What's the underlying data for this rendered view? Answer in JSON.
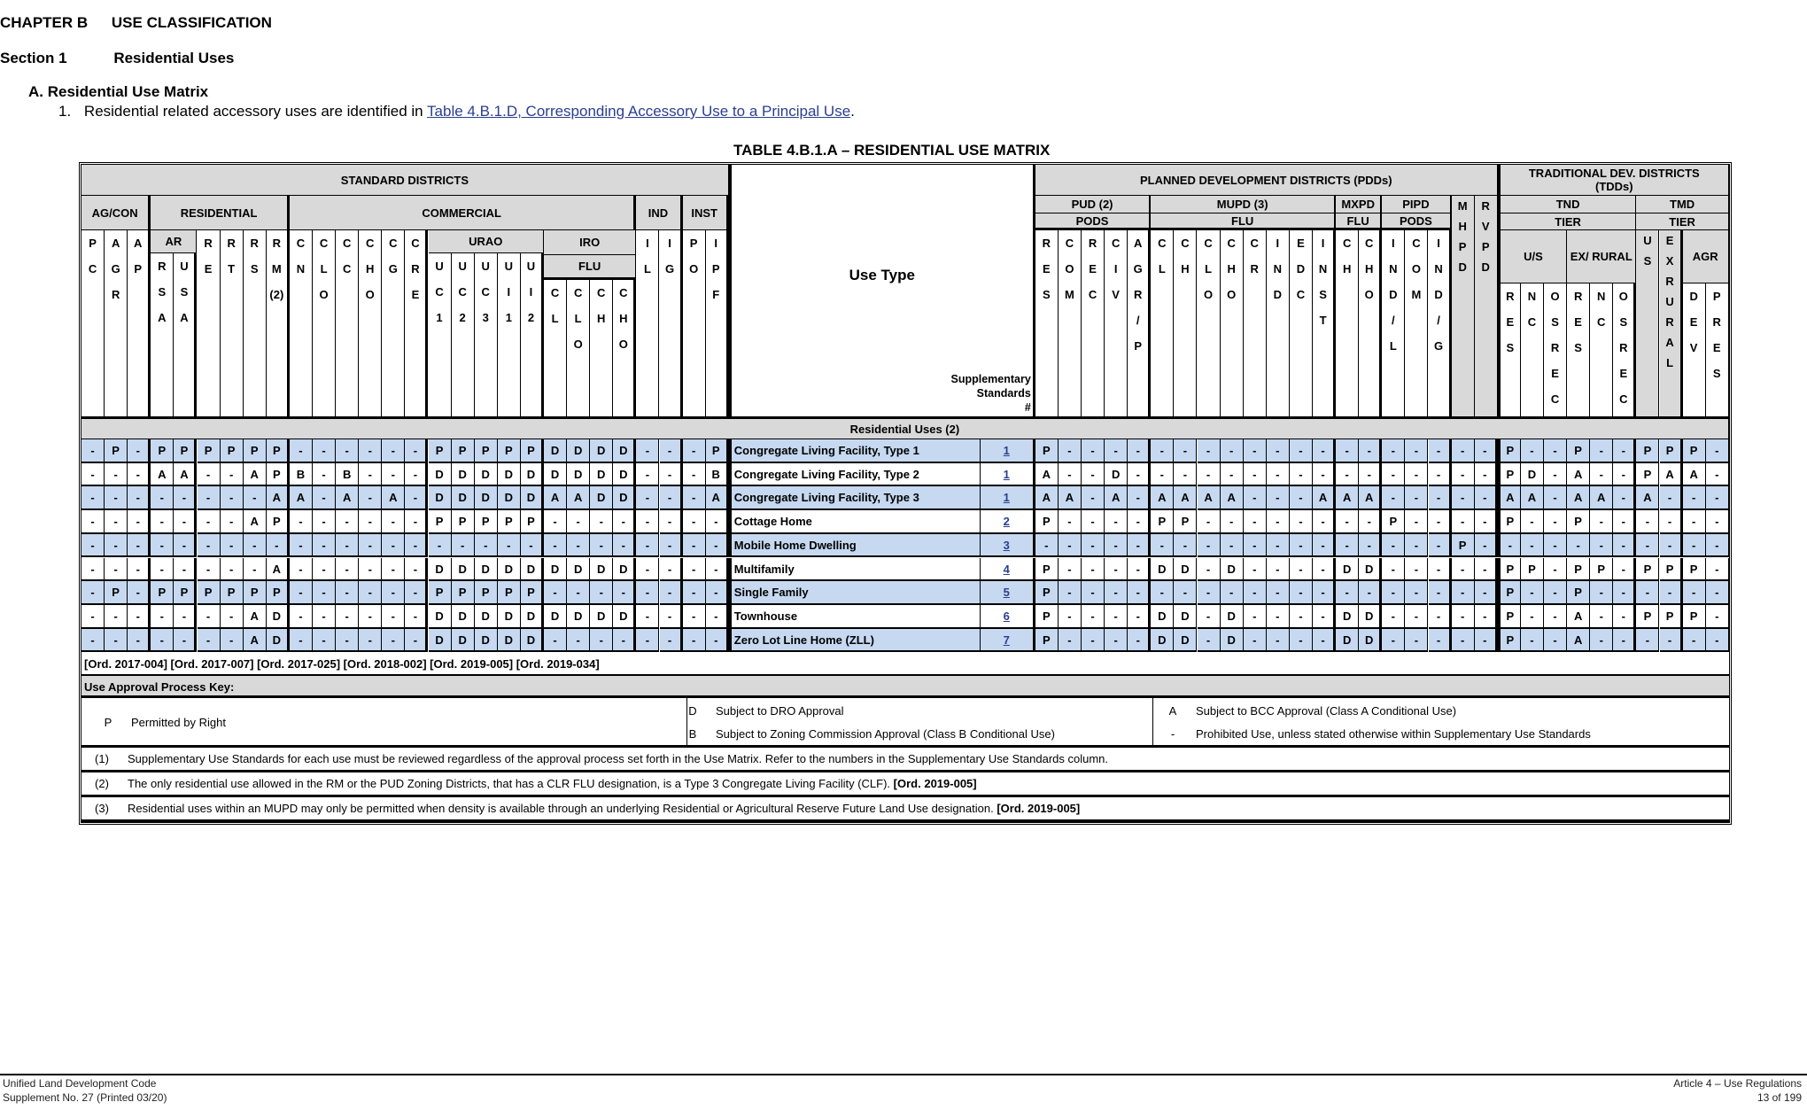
{
  "heading": {
    "chapter_label": "CHAPTER B",
    "chapter_title": "USE CLASSIFICATION",
    "section_label": "Section 1",
    "section_title": "Residential Uses",
    "subsection": "A.  Residential Use Matrix",
    "item_number": "1.",
    "item_text": "Residential related accessory uses are identified in ",
    "item_link": "Table 4.B.1.D, Corresponding Accessory Use to a Principal Use",
    "item_end": "."
  },
  "table": {
    "title": "TABLE 4.B.1.A – RESIDENTIAL USE MATRIX",
    "use_type_header": "Use Type",
    "supplementary_header": [
      "Supplementary",
      "Standards",
      "#"
    ],
    "standard_districts": "STANDARD DISTRICTS",
    "pdd_header": "PLANNED DEVELOPMENT DISTRICTS (PDDs)",
    "tdd_header": "TRADITIONAL DEV. DISTRICTS (TDDs)",
    "std_groups": [
      {
        "label": "AG/CON",
        "span": 3
      },
      {
        "label": "RESIDENTIAL",
        "span": 6
      },
      {
        "label": "COMMERCIAL",
        "span": 15
      },
      {
        "label": "IND",
        "span": 2
      },
      {
        "label": "INST",
        "span": 2
      }
    ],
    "std_subgroups": [
      {
        "label": "AR",
        "start": 3,
        "span": 2
      },
      {
        "label": "URAO",
        "start": 15,
        "span": 5
      },
      {
        "label": "IRO",
        "start": 20,
        "span": 4
      },
      {
        "label": "FLU",
        "start": 20,
        "span": 4
      }
    ],
    "std_columns": [
      "PC",
      "AGR",
      "AP",
      "RSA",
      "USA",
      "RE",
      "RT",
      "RS",
      "RM(2)",
      "CN",
      "CLO",
      "CC",
      "CHO",
      "CG",
      "CRE",
      "UC1",
      "UC2",
      "UC3",
      "UI1",
      "UI2",
      "CL",
      "CLO",
      "CH",
      "CHO",
      "IL",
      "IG",
      "PO",
      "IPF"
    ],
    "pdd_groups": [
      {
        "label": "PUD (2)",
        "sub": "PODS",
        "span": 5
      },
      {
        "label": "MUPD (3)",
        "sub": "FLU",
        "span": 8
      },
      {
        "label": "MXPD",
        "sub": "FLU",
        "span": 2
      },
      {
        "label": "PIPD",
        "sub": "PODS",
        "span": 3
      },
      {
        "label": "MHPD",
        "sub": "",
        "span": 1
      },
      {
        "label": "RVPD",
        "sub": "",
        "span": 1
      }
    ],
    "pdd_columns": [
      "RES",
      "COM",
      "REC",
      "CIV",
      "AGR/P",
      "CL",
      "CH",
      "CLO",
      "CHO",
      "CR",
      "IND",
      "EDC",
      "INST",
      "CH",
      "CHO",
      "IND/L",
      "COM",
      "IND/G",
      "MHPD",
      "RVPD"
    ],
    "tdd_groups": [
      {
        "label": "TND",
        "sub": "TIER",
        "span": 6
      },
      {
        "label": "TMD",
        "sub": "TIER",
        "span": 4
      }
    ],
    "tdd_subgroups": [
      {
        "label": "U/S",
        "span": 3
      },
      {
        "label": "EX/ RURAL",
        "span": 3
      },
      {
        "label": "US",
        "span": 1
      },
      {
        "label": "EXRURAL",
        "span": 1
      },
      {
        "label": "AGR",
        "span": 2
      }
    ],
    "tdd_columns": [
      "RES",
      "NC",
      "OSREC",
      "RES",
      "NC",
      "OSREC",
      "US",
      "EXRURAL",
      "DEV",
      "PRES"
    ],
    "section_row": "Residential Uses (2)",
    "rows": [
      {
        "use": "Congregate Living Facility, Type 1",
        "sup": "1",
        "std": "-P-PPPPPP------PPPPPDDDD---P",
        "pdd": "P-------------------",
        "tdd": "P--P--PPP-"
      },
      {
        "use": "Congregate Living Facility, Type 2",
        "sup": "1",
        "std": "---AA--APB-B---DDDDDDDDD---B",
        "pdd": "A--D----------------",
        "tdd": "PD-A--PAA-"
      },
      {
        "use": "Congregate Living Facility, Type 3",
        "sup": "1",
        "std": "--------AA-A-A-DDDDDAADD---A",
        "pdd": "AA-A-AAAA---AAA-----",
        "tdd": "AA-AA-A---"
      },
      {
        "use": "Cottage Home",
        "sup": "2",
        "std": "-------AP------PPPPP--------",
        "pdd": "P----PP--------P----",
        "tdd": "P--P------"
      },
      {
        "use": "Mobile Home Dwelling",
        "sup": "3",
        "std": "----------------------------",
        "pdd": "------------------P-",
        "tdd": "----------"
      },
      {
        "use": "Multifamily",
        "sup": "4",
        "std": "--------A------DDDDDDDDD----",
        "pdd": "P----DD-D----DD-----",
        "tdd": "PP-PP-PPP-"
      },
      {
        "use": "Single Family",
        "sup": "5",
        "std": "-P-PPPPPP------PPPPP--------",
        "pdd": "P-------------------",
        "tdd": "P--P------"
      },
      {
        "use": "Townhouse",
        "sup": "6",
        "std": "-------AD------DDDDDDDDD----",
        "pdd": "P----DD-D----DD-----",
        "tdd": "P--A--PPP-"
      },
      {
        "use": "Zero Lot Line Home (ZLL)",
        "sup": "7",
        "std": "-------AD------DDDDD--------",
        "pdd": "P----DD-D----DD-----",
        "tdd": "P--A------"
      }
    ],
    "ordinances": "[Ord. 2017-004] [Ord. 2017-007] [Ord. 2017-025] [Ord. 2018-002] [Ord. 2019-005] [Ord. 2019-034]",
    "key_header": "Use Approval Process Key:",
    "key": [
      {
        "code": "P",
        "text": "Permitted by Right"
      },
      {
        "code": "D",
        "text": "Subject to DRO Approval"
      },
      {
        "code": "B",
        "text": "Subject to Zoning Commission Approval (Class B Conditional Use)"
      },
      {
        "code": "A",
        "text": "Subject to BCC Approval (Class A Conditional Use)"
      },
      {
        "code": "-",
        "text": "Prohibited Use, unless stated otherwise within Supplementary Use Standards"
      }
    ],
    "notes": [
      {
        "num": "(1)",
        "text": "Supplementary Use Standards for each use must be reviewed regardless of the approval process set forth in the Use Matrix. Refer to the numbers in the Supplementary Use Standards column.",
        "ord": ""
      },
      {
        "num": "(2)",
        "text": "The only residential use allowed in the RM or the PUD Zoning Districts, that has a CLR FLU designation, is a Type 3 Congregate Living Facility (CLF). ",
        "ord": "[Ord. 2019-005]"
      },
      {
        "num": "(3)",
        "text": "Residential uses within an MUPD may only be permitted when density is available through an underlying Residential or Agricultural Reserve Future Land Use designation. ",
        "ord": "[Ord. 2019-005]"
      }
    ]
  },
  "footer": {
    "left_line1": "Unified Land Development Code",
    "left_line2": "Supplement No. 27 (Printed 03/20)",
    "right_line1": "Article 4 – Use Regulations",
    "right_line2": "13 of 199"
  },
  "colors": {
    "row_blue": "#c6d9f1",
    "header_gray": "#d9d9d9",
    "link": "#2a3f8f"
  }
}
